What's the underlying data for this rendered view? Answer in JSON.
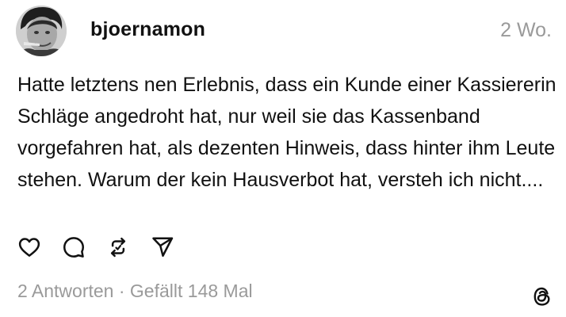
{
  "post": {
    "username": "bjoernamon",
    "time": "2 Wo.",
    "text": "Hatte letztens nen Erlebnis, dass ein Kunde einer Kassiererin Schläge angedroht hat, nur weil sie das Kassenband vorgefahren hat, als dezenten Hinweis, dass hinter ihm Leute stehen. Warum der kein Hausverbot hat, versteh ich nicht....",
    "replies": "2 Antworten",
    "separator": " · ",
    "likes": "Gefällt 148 Mal"
  },
  "icons": {
    "like": "heart-icon",
    "reply": "comment-icon",
    "repost": "repost-icon",
    "share": "send-icon",
    "app": "threads-logo-icon"
  },
  "colors": {
    "text": "#111111",
    "muted": "#9a9a9a",
    "background": "#ffffff"
  }
}
